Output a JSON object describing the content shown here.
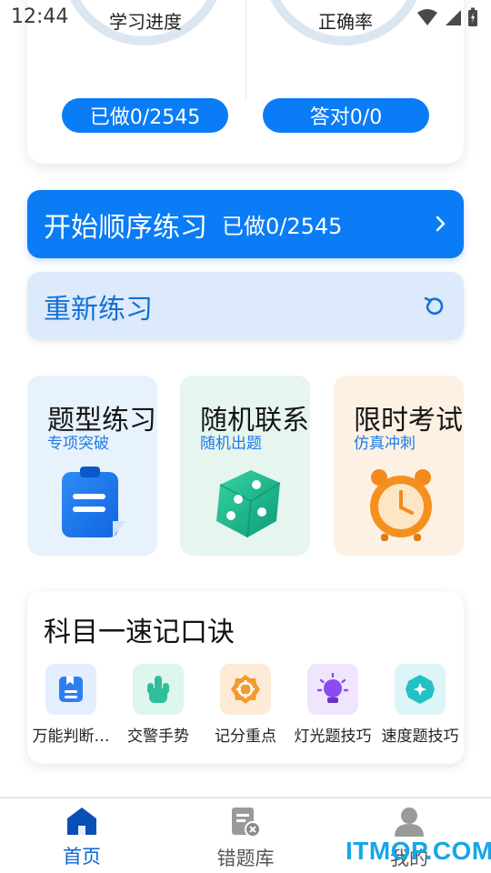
{
  "status_bar": {
    "time": "12:44"
  },
  "progress": {
    "study_progress_label": "学习进度",
    "accuracy_label": "正确率",
    "done_pill": "已做0/2545",
    "correct_pill": "答对0/0"
  },
  "start_practice": {
    "label": "开始顺序练习",
    "count": "已做0/2545"
  },
  "redo": {
    "label": "重新练习"
  },
  "modes": [
    {
      "title": "题型练习",
      "subtitle": "专项突破",
      "icon": "clipboard-icon"
    },
    {
      "title": "随机联系",
      "subtitle": "随机出题",
      "icon": "dice-icon"
    },
    {
      "title": "限时考试",
      "subtitle": "仿真冲刺",
      "icon": "alarm-clock-icon"
    }
  ],
  "mnemonic": {
    "title": "科目一速记口诀",
    "items": [
      {
        "label": "万能判断…",
        "icon": "bookmark-doc-icon",
        "color": "#2f7ef0"
      },
      {
        "label": "交警手势",
        "icon": "hand-gesture-icon",
        "color": "#2ebf9a"
      },
      {
        "label": "记分重点",
        "icon": "target-badge-icon",
        "color": "#f59a2e"
      },
      {
        "label": "灯光题技巧",
        "icon": "light-bulb-icon",
        "color": "#8a4bf0"
      },
      {
        "label": "速度题技巧",
        "icon": "speed-gem-icon",
        "color": "#22c1c7"
      }
    ]
  },
  "bottom_nav": {
    "home": "首页",
    "wrong_questions": "错题库",
    "mine": "我的"
  },
  "watermark": "ITMOP.COM",
  "colors": {
    "primary": "#0a7cf5",
    "light_blue": "#dceafb",
    "active_nav": "#0a66d8"
  }
}
